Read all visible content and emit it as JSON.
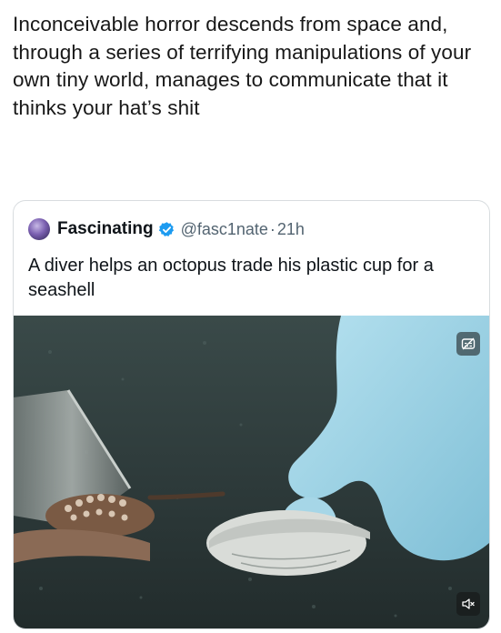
{
  "post": {
    "caption": "Inconceivable horror descends from space and, through a series of terrifying manipulations of your own tiny world, manages to communicate that it thinks your hat’s shit"
  },
  "quote": {
    "name": "Fascinating",
    "handle": "@fasc1nate",
    "separator": "·",
    "time": "21h",
    "text": "A diver helps an octopus trade his plastic cup for a seashell",
    "media": {
      "gif_icon": "caption-toggle-icon",
      "mute_icon": "mute-icon"
    }
  },
  "colors": {
    "verified": "#1d9bf0",
    "handle_gray": "#536471",
    "glove": "#9fd3e6",
    "seafloor": "#2f3c3c"
  }
}
